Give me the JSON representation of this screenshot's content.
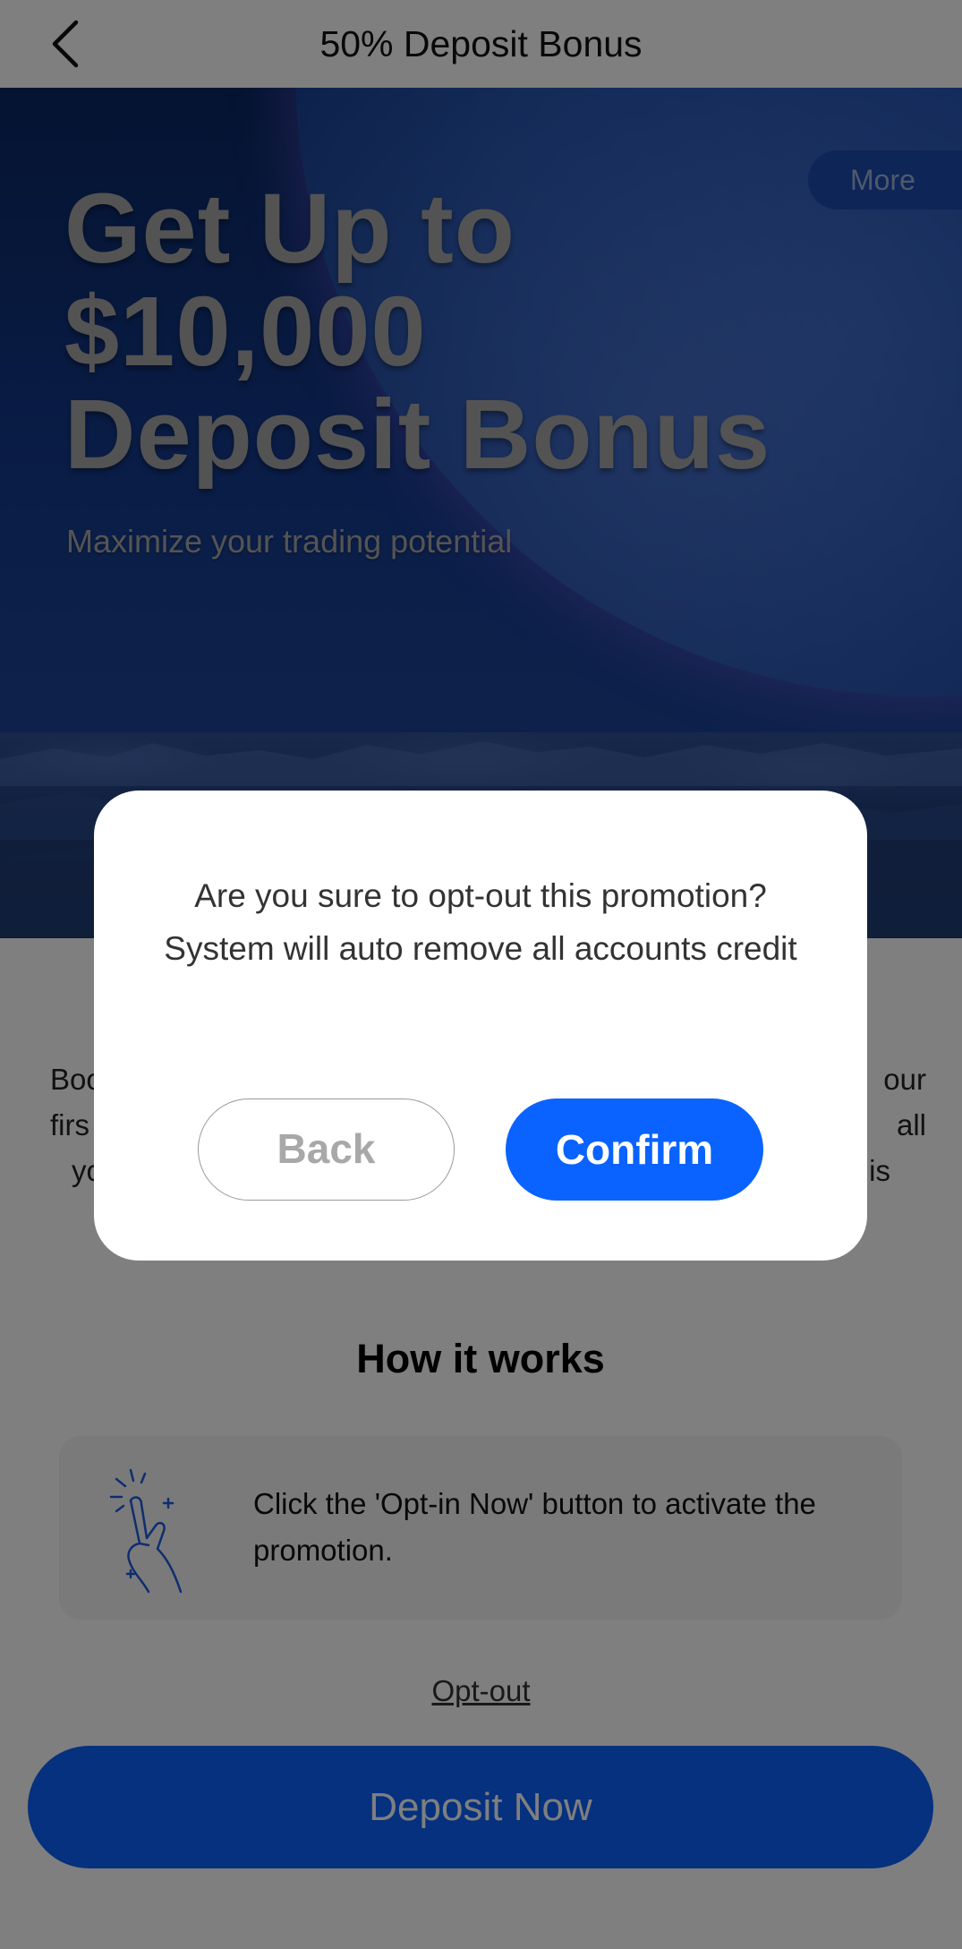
{
  "header": {
    "title": "50% Deposit Bonus",
    "back_icon": "chevron-left-icon"
  },
  "hero": {
    "more_label": "More",
    "title_line1": "Get Up to",
    "title_line2": "$10,000",
    "title_line3": "Deposit Bonus",
    "subtitle": "Maximize your trading potential"
  },
  "intro": {
    "line1_left": "Boo",
    "line1_right": "our",
    "line2_left": "firs",
    "line2_right": "all",
    "line3_left": "yo",
    "line3_right": "is"
  },
  "how_it_works": {
    "title": "How it works",
    "steps": [
      {
        "icon": "tap-hand-icon",
        "text": "Click the 'Opt-in Now' button to activate the promotion."
      }
    ]
  },
  "footer": {
    "optout_label": "Opt-out",
    "deposit_label": "Deposit Now"
  },
  "dialog": {
    "message": "Are you sure to opt-out this promotion? System will auto remove all accounts credit",
    "back_label": "Back",
    "confirm_label": "Confirm"
  },
  "colors": {
    "primary": "#0a63ff",
    "overlay": "rgba(0,0,0,0.5)",
    "hero_bg": "#143a8e",
    "icon_blue": "#1d5de0"
  }
}
